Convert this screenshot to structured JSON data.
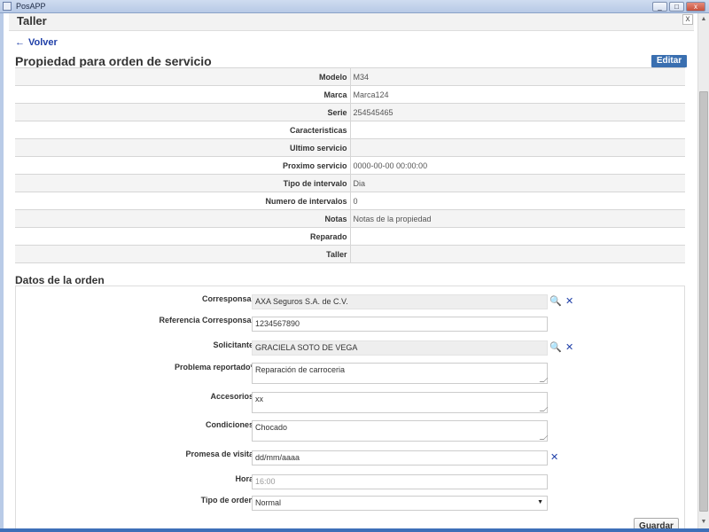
{
  "window": {
    "title": "PosAPP",
    "min": "_",
    "max": "□",
    "close": "x"
  },
  "modal": {
    "title": "Taller",
    "close": "x"
  },
  "nav": {
    "back_arrow": "←",
    "back_label": "Volver"
  },
  "page": {
    "title": "Propiedad para orden de servicio",
    "edit_label": "Editar"
  },
  "properties": [
    {
      "label": "Modelo",
      "value": "M34"
    },
    {
      "label": "Marca",
      "value": "Marca124"
    },
    {
      "label": "Serie",
      "value": "254545465"
    },
    {
      "label": "Caracteristicas",
      "value": ""
    },
    {
      "label": "Ultimo servicio",
      "value": ""
    },
    {
      "label": "Proximo servicio",
      "value": "0000-00-00 00:00:00"
    },
    {
      "label": "Tipo de intervalo",
      "value": "Dia"
    },
    {
      "label": "Numero de intervalos",
      "value": "0"
    },
    {
      "label": "Notas",
      "value": "Notas de la propiedad"
    },
    {
      "label": "Reparado",
      "value": ""
    },
    {
      "label": "Taller",
      "value": ""
    }
  ],
  "order": {
    "section_title": "Datos de la orden",
    "corresponsal": {
      "label": "Corresponsal",
      "value": "AXA Seguros S.A. de C.V."
    },
    "referencia": {
      "label": "Referencia Corresponsal",
      "value": "1234567890"
    },
    "solicitante": {
      "label": "Solicitante",
      "value": "GRACIELA SOTO DE VEGA"
    },
    "problema": {
      "label": "Problema reportado*",
      "value": "Reparación de carroceria"
    },
    "accesorios": {
      "label": "Accesorios",
      "value": "xx"
    },
    "condiciones": {
      "label": "Condiciones",
      "value": "Chocado"
    },
    "promesa": {
      "label": "Promesa de visita",
      "placeholder": "dd/mm/aaaa"
    },
    "hora": {
      "label": "Hora",
      "value": "16:00"
    },
    "tipo_orden": {
      "label": "Tipo de orden",
      "value": "Normal"
    },
    "save_label": "Guardar"
  },
  "icons": {
    "search": "🔍",
    "clear": "✕",
    "caret": "▼"
  },
  "colors": {
    "accent": "#3a6fb0",
    "link": "#1f3fa8"
  }
}
